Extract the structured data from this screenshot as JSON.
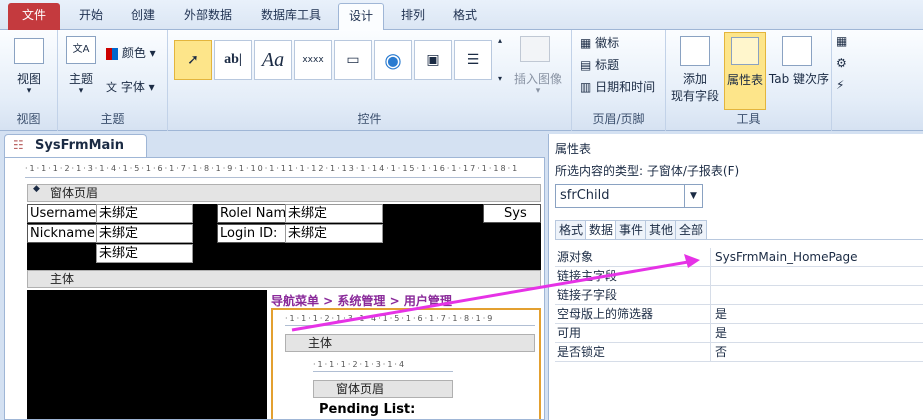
{
  "tabs": [
    "文件",
    "开始",
    "创建",
    "外部数据",
    "数据库工具",
    "设计",
    "排列",
    "格式"
  ],
  "ribbon": {
    "view": {
      "label": "视图",
      "group": "视图"
    },
    "theme": {
      "theme": "主题",
      "colors": "颜色",
      "fonts": "字体",
      "group": "主题"
    },
    "controls": {
      "group": "控件",
      "text_ab": "ab|",
      "text_aa": "Aa",
      "text_xxxx": "xxxx",
      "insert_image": "插入图像"
    },
    "header_footer": {
      "logo": "徽标",
      "title": "标题",
      "datetime": "日期和时间",
      "group": "页眉/页脚"
    },
    "tools": {
      "add_fields_1": "添加",
      "add_fields_2": "现有字段",
      "property_sheet": "属性表",
      "tab_order": "Tab 键次序",
      "group": "工具"
    }
  },
  "document": {
    "tab_title": "SysFrmMain",
    "form_header": "窗体页眉",
    "detail": "主体",
    "labels": {
      "username": "Username:",
      "nickname": "Nickname:",
      "role_name": "Rolel Name",
      "login_id": "Login ID:",
      "sys": "Sys"
    },
    "unbound": "未绑定",
    "breadcrumb": "导航菜单 > 系统管理 > 用户管理",
    "sub_detail": "主体",
    "sub_form_header": "窗体页眉",
    "pending_list": "Pending List:"
  },
  "property_sheet": {
    "title": "属性表",
    "selection_type": "所选内容的类型:  子窗体/子报表(F)",
    "selected_object": "sfrChild",
    "tabs": [
      "格式",
      "数据",
      "事件",
      "其他",
      "全部"
    ],
    "active_tab": "数据",
    "rows": [
      {
        "key": "源对象",
        "value": "SysFrmMain_HomePage"
      },
      {
        "key": "链接主字段",
        "value": ""
      },
      {
        "key": "链接子字段",
        "value": ""
      },
      {
        "key": "空母版上的筛选器",
        "value": "是"
      },
      {
        "key": "可用",
        "value": "是"
      },
      {
        "key": "是否锁定",
        "value": "否"
      }
    ]
  },
  "colors": {
    "file_tab": "#c43a3e",
    "arrow": "#e632e6",
    "selected": "#fde58a"
  }
}
